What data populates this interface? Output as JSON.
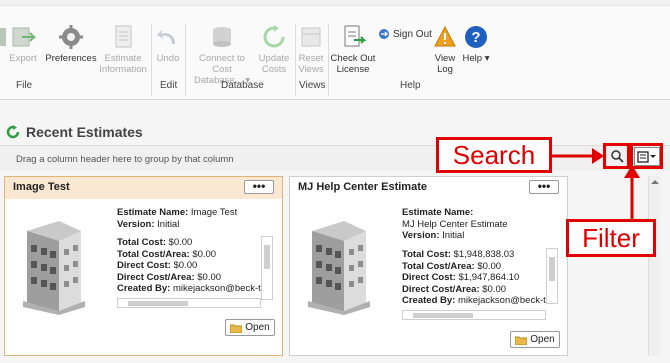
{
  "ribbon": {
    "buttons": [
      {
        "label": "",
        "icon": "partial-icon",
        "disabled": true
      },
      {
        "label": "Export",
        "icon": "export-icon",
        "disabled": true
      },
      {
        "label": "Preferences",
        "icon": "gear-icon",
        "disabled": false
      },
      {
        "label": "Estimate Information",
        "icon": "document-icon",
        "disabled": true
      },
      {
        "label": "Undo",
        "icon": "undo-icon",
        "disabled": true
      },
      {
        "label": "Connect to Cost Database... ▾",
        "icon": "database-icon",
        "disabled": true
      },
      {
        "label": "Update Costs",
        "icon": "refresh-icon",
        "disabled": true
      },
      {
        "label": "Reset Views",
        "icon": "reset-views-icon",
        "disabled": true
      },
      {
        "label": "Check Out License",
        "icon": "license-icon",
        "disabled": false
      },
      {
        "label": "View Log",
        "icon": "warning-icon",
        "disabled": false
      },
      {
        "label": "Help ▾",
        "icon": "help-icon",
        "disabled": false
      }
    ],
    "sign_out": "Sign Out",
    "groups": [
      "File",
      "Edit",
      "Database",
      "Views",
      "Help"
    ]
  },
  "section": {
    "title": "Recent Estimates",
    "group_hint": "Drag a column header here to group by that column"
  },
  "cards": [
    {
      "title": "Image Test",
      "estimate_name_label": "Estimate Name:",
      "estimate_name": "Image Test",
      "version_label": "Version:",
      "version": "Initial",
      "costs": [
        {
          "label": "Total Cost:",
          "value": "$0.00"
        },
        {
          "label": "Total Cost/Area:",
          "value": "$0.00"
        },
        {
          "label": "Direct Cost:",
          "value": "$0.00"
        },
        {
          "label": "Direct Cost/Area:",
          "value": "$0.00"
        },
        {
          "label": "Created By:",
          "value": "mikejackson@beck-te"
        }
      ],
      "open_label": "Open",
      "menu": "•••"
    },
    {
      "title": "MJ Help Center Estimate",
      "estimate_name_label": "Estimate Name:",
      "estimate_name": "MJ Help Center Estimate",
      "version_label": "Version:",
      "version": "Initial",
      "costs": [
        {
          "label": "Total Cost:",
          "value": "$1,948,838.03"
        },
        {
          "label": "Total Cost/Area:",
          "value": "$0.00"
        },
        {
          "label": "Direct Cost:",
          "value": "$1,947,864.10"
        },
        {
          "label": "Direct Cost/Area:",
          "value": "$0.00"
        },
        {
          "label": "Created By:",
          "value": "mikejackson@beck-te"
        }
      ],
      "open_label": "Open",
      "menu": "•••"
    }
  ],
  "annotations": {
    "search": "Search",
    "filter": "Filter"
  },
  "colors": {
    "annotation": "#e00000",
    "selected_header": "#fbe8d2",
    "refresh_green": "#2e9e3e"
  }
}
